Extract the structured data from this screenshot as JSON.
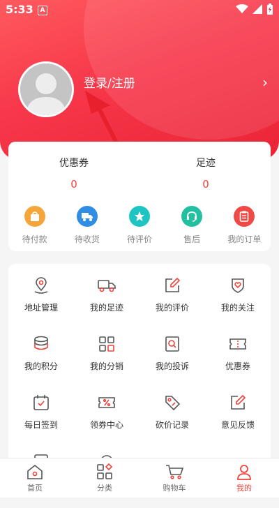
{
  "status": {
    "time": "5:33",
    "notif": "A"
  },
  "profile": {
    "login_label": "登录/注册"
  },
  "stats": [
    {
      "label": "优惠券",
      "value": "0"
    },
    {
      "label": "足迹",
      "value": "0"
    }
  ],
  "orders": [
    {
      "label": "待付款",
      "icon": "bag-icon",
      "color": "#f5a63b"
    },
    {
      "label": "待收货",
      "icon": "truck-icon",
      "color": "#2f8de4"
    },
    {
      "label": "待评价",
      "icon": "star-icon",
      "color": "#1fc5c2"
    },
    {
      "label": "售后",
      "icon": "headset-icon",
      "color": "#22c0a0"
    },
    {
      "label": "我的订单",
      "icon": "order-list-icon",
      "color": "#ef4a45"
    }
  ],
  "services": [
    {
      "label": "地址管理",
      "icon": "location-icon"
    },
    {
      "label": "我的足迹",
      "icon": "truck-outline-icon"
    },
    {
      "label": "我的评价",
      "icon": "edit-icon"
    },
    {
      "label": "我的关注",
      "icon": "heart-icon"
    },
    {
      "label": "我的积分",
      "icon": "coins-icon"
    },
    {
      "label": "我的分销",
      "icon": "grid-icon"
    },
    {
      "label": "我的投诉",
      "icon": "complaint-icon"
    },
    {
      "label": "优惠券",
      "icon": "ticket-icon"
    },
    {
      "label": "每日签到",
      "icon": "calendar-check-icon"
    },
    {
      "label": "领券中心",
      "icon": "coupon-percent-icon"
    },
    {
      "label": "砍价记录",
      "icon": "tag-icon"
    },
    {
      "label": "意见反馈",
      "icon": "feedback-icon"
    }
  ],
  "tabs": [
    {
      "label": "首页",
      "icon": "home-icon",
      "active": false
    },
    {
      "label": "分类",
      "icon": "category-icon",
      "active": false
    },
    {
      "label": "购物车",
      "icon": "cart-icon",
      "active": false
    },
    {
      "label": "我的",
      "icon": "user-icon",
      "active": true
    }
  ],
  "colors": {
    "accent": "#f0433a",
    "line_icon": "#555555"
  }
}
